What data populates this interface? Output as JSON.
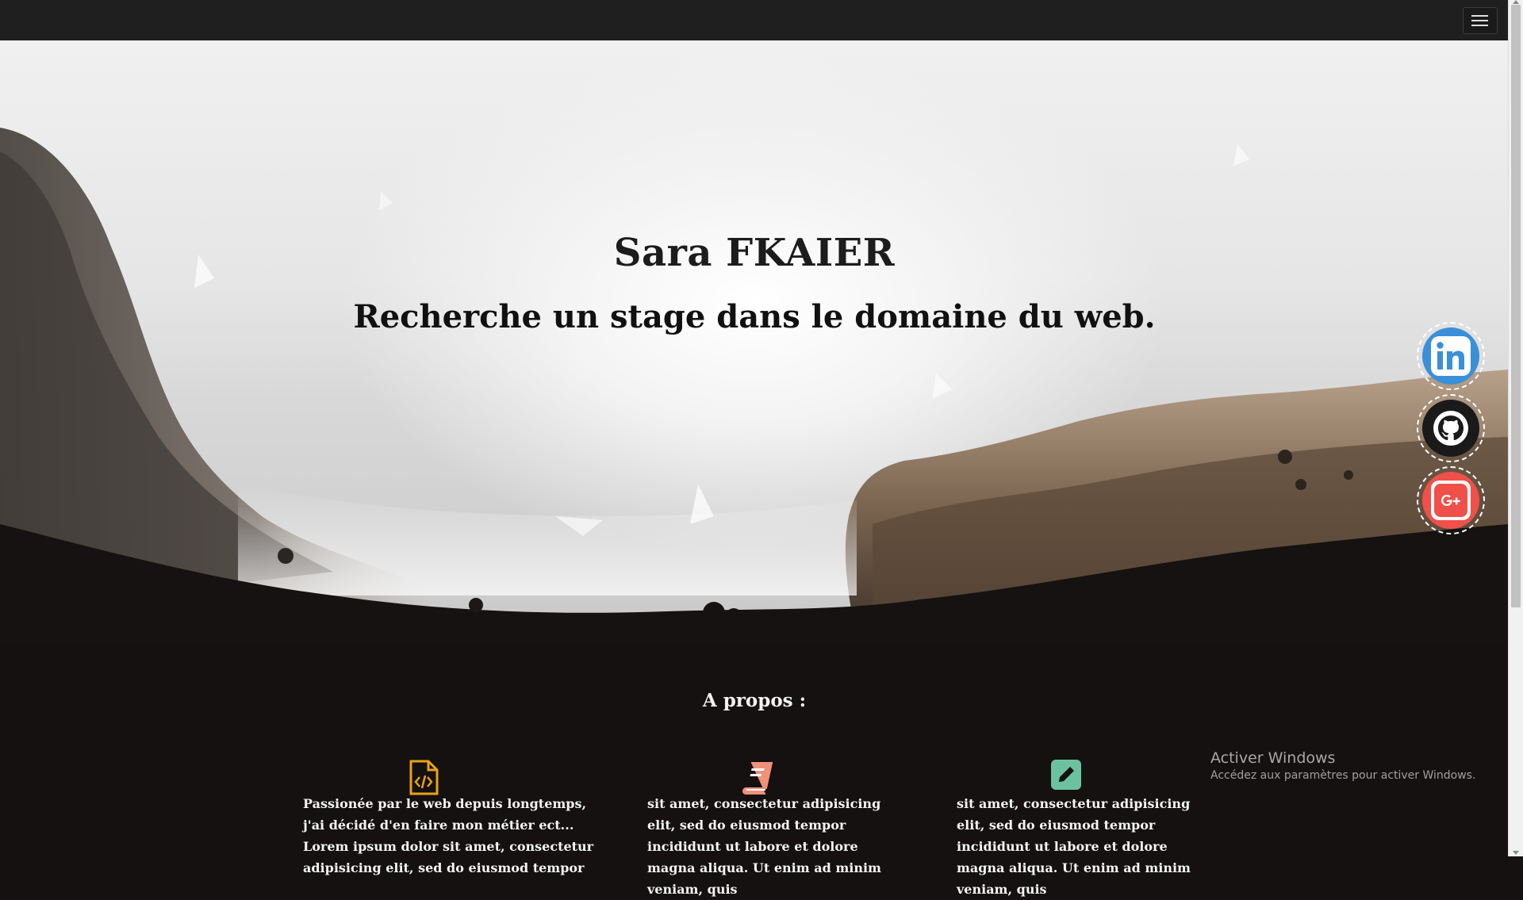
{
  "hero": {
    "title": "Sara FKAIER",
    "subtitle": "Recherche un stage dans le domaine du web."
  },
  "social": [
    {
      "name": "linkedin-icon",
      "color": "#3a8fd9"
    },
    {
      "name": "github-icon",
      "color": "#1a1a1a"
    },
    {
      "name": "google-plus-icon",
      "color": "#f0504a"
    }
  ],
  "about": {
    "title": "A propos :",
    "columns": [
      {
        "icon": "code-file-icon",
        "icon_color": "#e5a31a",
        "text": "Passionée par le web depuis longtemps, j'ai décidé d'en faire mon métier ect... Lorem ipsum dolor sit amet, consectetur adipisicing elit, sed do eiusmod tempor"
      },
      {
        "icon": "book-icon",
        "icon_color": "#f0917a",
        "text": "sit amet, consectetur adipisicing elit, sed do eiusmod tempor incididunt ut labore et dolore magna aliqua. Ut enim ad minim veniam, quis"
      },
      {
        "icon": "edit-icon",
        "icon_color": "#6cc2a0",
        "text": "sit amet, consectetur adipisicing elit, sed do eiusmod tempor incididunt ut labore et dolore magna aliqua. Ut enim ad minim veniam, quis"
      }
    ]
  },
  "os_watermark": {
    "line1": "Activer Windows",
    "line2": "Accédez aux paramètres pour activer Windows."
  }
}
